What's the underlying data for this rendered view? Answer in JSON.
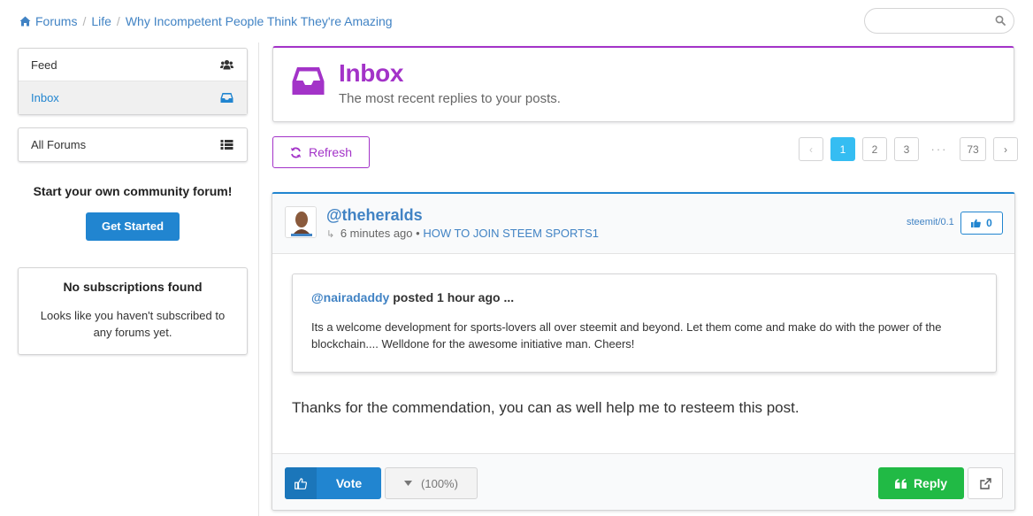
{
  "breadcrumb": {
    "items": [
      "Forums",
      "Life",
      "Why Incompetent People Think They're Amazing"
    ]
  },
  "search": {
    "placeholder": ""
  },
  "sidebar": {
    "menu": [
      {
        "label": "Feed",
        "icon": "users-icon"
      },
      {
        "label": "Inbox",
        "icon": "inbox-icon",
        "active": true
      }
    ],
    "all_forums": {
      "label": "All Forums",
      "icon": "list-icon"
    },
    "promo": {
      "title": "Start your own community forum!",
      "button": "Get Started"
    },
    "no_subscriptions": {
      "title": "No subscriptions found",
      "text": "Looks like you haven't subscribed to any forums yet."
    }
  },
  "inbox": {
    "title": "Inbox",
    "subtitle": "The most recent replies to your posts."
  },
  "toolbar": {
    "refresh_label": "Refresh"
  },
  "pagination": {
    "prev": "‹",
    "pages": [
      "1",
      "2",
      "3"
    ],
    "ellipsis": "···",
    "last": "73",
    "next": "›",
    "current": "1"
  },
  "reply": {
    "author": "@theheralds",
    "time": "6 minutes ago",
    "bullet": "•",
    "post_title": "HOW TO JOIN STEEM SPORTS1",
    "app": "steemit/0.1",
    "vote_count": "0",
    "quote": {
      "author": "@nairadaddy",
      "posted": "posted",
      "time": "1 hour ago",
      "ellipsis": "...",
      "body": "Its a welcome development for sports-lovers all over steemit and beyond. Let them come and make do with the power of the blockchain.... Welldone for the awesome initiative man. Cheers!"
    },
    "text": "Thanks for the commendation, you can as well help me to resteem this post.",
    "vote_label": "Vote",
    "weight_label": "(100%)",
    "reply_label": "Reply"
  },
  "colors": {
    "accent_purple": "#a333c8",
    "link_blue": "#4183c4",
    "primary_blue": "#2185d0",
    "page_active": "#35bdf2",
    "reply_green": "#21ba45"
  }
}
